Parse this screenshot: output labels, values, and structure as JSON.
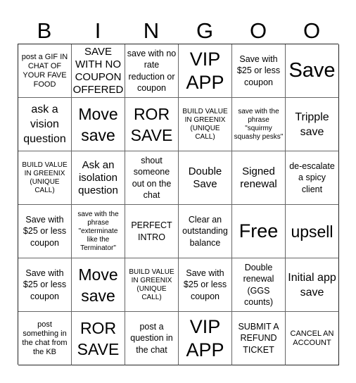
{
  "header": {
    "letters": [
      "B",
      "I",
      "N",
      "G",
      "O",
      "O"
    ]
  },
  "rows": [
    [
      {
        "text": "post a GIF IN CHAT OF YOUR FAVE FOOD",
        "size": "s-sm"
      },
      {
        "text": "SAVE WITH NO COUPON OFFERED",
        "size": "s-lg"
      },
      {
        "text": "save with no rate reduction or coupon",
        "size": "s-md"
      },
      {
        "text": "VIP APP",
        "size": "s-3xl"
      },
      {
        "text": "Save with $25 or less coupon",
        "size": "s-md"
      },
      {
        "text": "Save",
        "size": "s-4xl"
      }
    ],
    [
      {
        "text": "ask a vision question",
        "size": "s-xl"
      },
      {
        "text": "Move save",
        "size": "s-2xl"
      },
      {
        "text": "ROR SAVE",
        "size": "s-2xl"
      },
      {
        "text": "BUILD VALUE IN GREENIX (UNIQUE CALL)",
        "size": "s-xs"
      },
      {
        "text": "save with the phrase \"squirmy squashy pesks\"",
        "size": "s-xs"
      },
      {
        "text": "Tripple save",
        "size": "s-xl"
      }
    ],
    [
      {
        "text": "BUILD VALUE IN GREENIX (UNIQUE CALL)",
        "size": "s-xs"
      },
      {
        "text": "Ask an isolation question",
        "size": "s-lg"
      },
      {
        "text": "shout someone out on the chat",
        "size": "s-md"
      },
      {
        "text": "Double Save",
        "size": "s-lg"
      },
      {
        "text": "Signed renewal",
        "size": "s-lg"
      },
      {
        "text": "de-escalate a spicy client",
        "size": "s-md"
      }
    ],
    [
      {
        "text": "Save with $25 or less coupon",
        "size": "s-md"
      },
      {
        "text": "save with the phrase \"exterminate like the Terminator\"",
        "size": "s-xs"
      },
      {
        "text": "PERFECT INTRO",
        "size": "s-md"
      },
      {
        "text": "Clear an outstanding balance",
        "size": "s-md"
      },
      {
        "text": "Free",
        "size": "s-3xl"
      },
      {
        "text": "upsell",
        "size": "s-2xl"
      }
    ],
    [
      {
        "text": "Save with $25 or less coupon",
        "size": "s-md"
      },
      {
        "text": "Move save",
        "size": "s-2xl"
      },
      {
        "text": "BUILD VALUE IN GREENIX (UNIQUE CALL)",
        "size": "s-xs"
      },
      {
        "text": "Save with $25 or less coupon",
        "size": "s-md"
      },
      {
        "text": "Double renewal (GGS counts)",
        "size": "s-md"
      },
      {
        "text": "Initial app save",
        "size": "s-xl"
      }
    ],
    [
      {
        "text": "post something in the chat from the KB",
        "size": "s-sm"
      },
      {
        "text": "ROR SAVE",
        "size": "s-2xl"
      },
      {
        "text": "post a question in the chat",
        "size": "s-md"
      },
      {
        "text": "VIP APP",
        "size": "s-3xl"
      },
      {
        "text": "SUBMIT A REFUND TICKET",
        "size": "s-md"
      },
      {
        "text": "CANCEL AN ACCOUNT",
        "size": "s-sm"
      }
    ]
  ]
}
